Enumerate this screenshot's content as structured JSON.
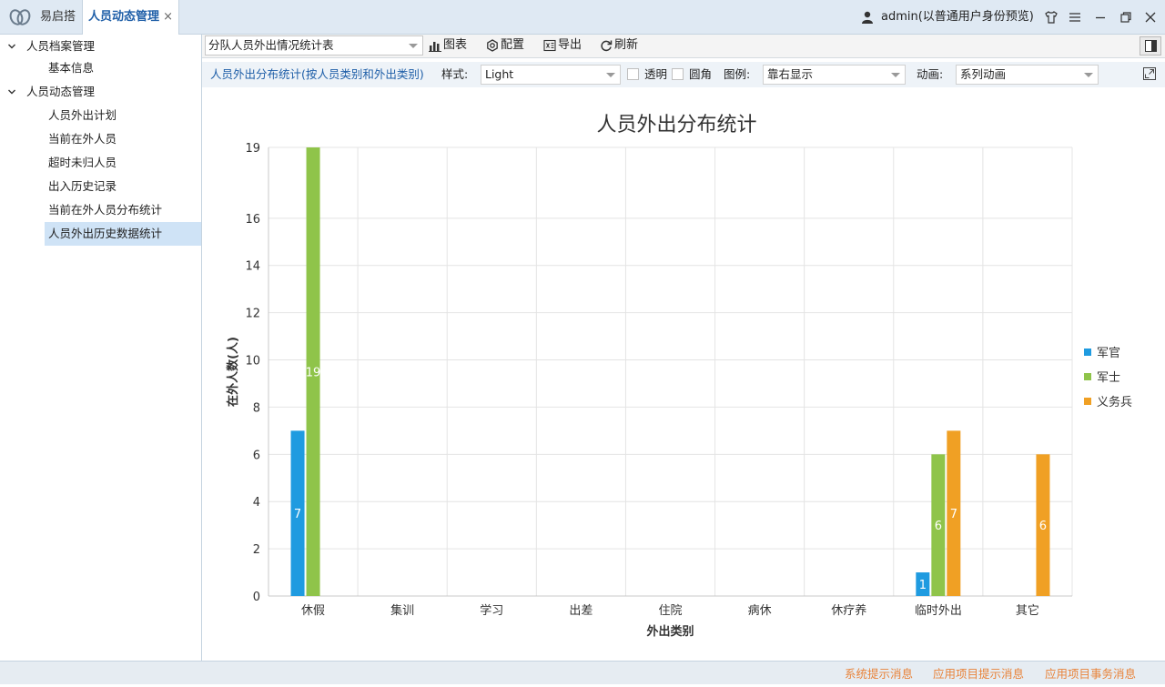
{
  "app": {
    "tabs": [
      {
        "label": "易启搭"
      },
      {
        "label": "人员动态管理",
        "close": "×"
      }
    ],
    "user": "admin(以普通用户身份预览)"
  },
  "sidebar": {
    "groups": [
      {
        "label": "人员档案管理",
        "items": [
          "基本信息"
        ]
      },
      {
        "label": "人员动态管理",
        "items": [
          "人员外出计划",
          "当前在外人员",
          "超时未归人员",
          "出入历史记录",
          "当前在外人员分布统计",
          "人员外出历史数据统计"
        ]
      }
    ],
    "selected": "人员外出历史数据统计"
  },
  "toolbar": {
    "report_select": "分队人员外出情况统计表",
    "chart_label": "图表",
    "config_label": "配置",
    "export_label": "导出",
    "refresh_label": "刷新"
  },
  "options": {
    "title": "人员外出分布统计(按人员类别和外出类别)",
    "style_label": "样式:",
    "style_value": "Light",
    "transparent_label": "透明",
    "rounded_label": "圆角",
    "legend_label": "图例:",
    "legend_value": "靠右显示",
    "animation_label": "动画:",
    "animation_value": "系列动画"
  },
  "chart_data": {
    "type": "bar",
    "title": "人员外出分布统计",
    "xlabel": "外出类别",
    "ylabel": "在外人数(人)",
    "categories": [
      "休假",
      "集训",
      "学习",
      "出差",
      "住院",
      "病休",
      "休疗养",
      "临时外出",
      "其它"
    ],
    "series": [
      {
        "name": "军官",
        "color": "#1f9be0",
        "values": [
          7,
          0,
          0,
          0,
          0,
          0,
          0,
          1,
          0
        ]
      },
      {
        "name": "军士",
        "color": "#8fc44a",
        "values": [
          19,
          0,
          0,
          0,
          0,
          0,
          0,
          6,
          0
        ]
      },
      {
        "name": "义务兵",
        "color": "#f0a024",
        "values": [
          0,
          0,
          0,
          0,
          0,
          0,
          0,
          7,
          6
        ]
      }
    ],
    "yticks": [
      0,
      2,
      4,
      6,
      8,
      10,
      12,
      14,
      16,
      19
    ],
    "ylim": [
      0,
      19
    ],
    "grid": true,
    "legend": "right"
  },
  "status": {
    "links": [
      "系统提示消息",
      "应用项目提示消息",
      "应用项目事务消息"
    ]
  }
}
